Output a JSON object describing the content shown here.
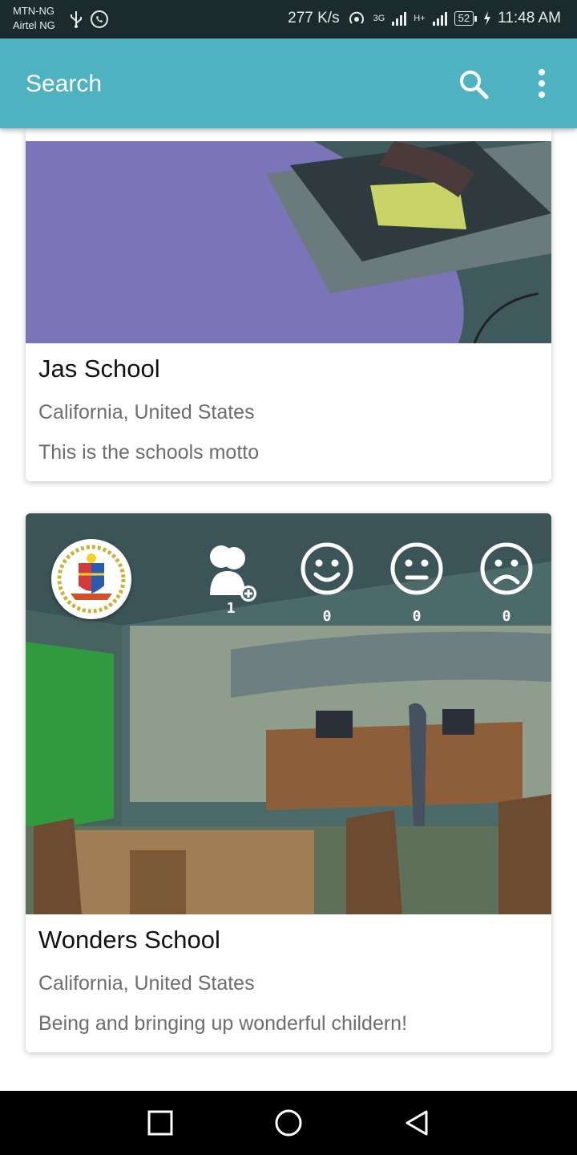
{
  "status_bar": {
    "carrier_1": "MTN-NG",
    "carrier_2": "Airtel NG",
    "speed": "277 K/s",
    "network_1": "3G",
    "network_2": "H+",
    "battery": "52",
    "time": "11:48 AM"
  },
  "toolbar": {
    "title": "Search",
    "search_icon": "search-icon",
    "menu_icon": "more-vert-icon"
  },
  "schools": [
    {
      "name": "Jas School",
      "location": "California, United States",
      "motto": "This is the schools motto"
    },
    {
      "name": "Wonders School",
      "location": "California, United States",
      "motto": "Being and bringing up wonderful childern!",
      "stats": {
        "followers": "1",
        "happy": "0",
        "neutral": "0",
        "sad": "0"
      }
    }
  ],
  "colors": {
    "primary": "#4fb2c0",
    "status_bar": "#1b2a2a",
    "nav_bar": "#000000"
  },
  "nav": {
    "recents_icon": "square-icon",
    "home_icon": "circle-icon",
    "back_icon": "triangle-back-icon"
  }
}
